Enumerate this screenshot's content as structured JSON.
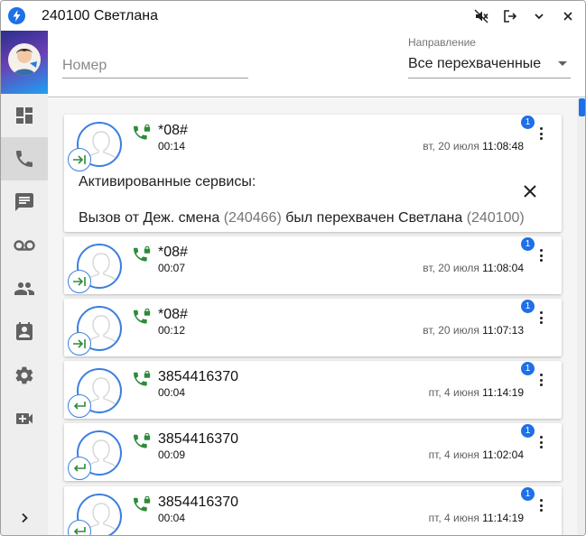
{
  "window": {
    "title": "240100 Светлана",
    "accent": "#1e6fe8"
  },
  "title_buttons": [
    {
      "name": "mute-icon"
    },
    {
      "name": "logout-icon"
    },
    {
      "name": "chevron-down-icon"
    },
    {
      "name": "close-icon"
    }
  ],
  "sidebar": {
    "items": [
      {
        "icon": "dashboard-icon",
        "active": false
      },
      {
        "icon": "phone-icon",
        "active": true
      },
      {
        "icon": "chat-icon",
        "active": false
      },
      {
        "icon": "voicemail-icon",
        "active": false
      },
      {
        "icon": "people-icon",
        "active": false
      },
      {
        "icon": "contacts-icon",
        "active": false
      },
      {
        "icon": "settings-icon",
        "active": false
      },
      {
        "icon": "video-call-icon",
        "active": false
      }
    ],
    "expand_icon": "chevron-right-icon"
  },
  "filters": {
    "number_placeholder": "Номер",
    "number_value": "",
    "direction_label": "Направление",
    "direction_value": "Все перехваченные"
  },
  "calls": [
    {
      "number": "*08#",
      "duration": "00:14",
      "date": "вт, 20 июля",
      "time": "11:08:48",
      "count": "1",
      "direction": "forwarded",
      "expanded": true,
      "services_title": "Активированные сервисы:",
      "desc_parts": [
        "Вызов от Деж. смена ",
        "(240466)",
        " был перехвачен Светлана ",
        "(240100)"
      ]
    },
    {
      "number": "*08#",
      "duration": "00:07",
      "date": "вт, 20 июля",
      "time": "11:08:04",
      "count": "1",
      "direction": "forwarded"
    },
    {
      "number": "*08#",
      "duration": "00:12",
      "date": "вт, 20 июля",
      "time": "11:07:13",
      "count": "1",
      "direction": "forwarded"
    },
    {
      "number": "3854416370",
      "duration": "00:04",
      "date": "пт, 4 июня",
      "time": "11:14:19",
      "count": "1",
      "direction": "incoming"
    },
    {
      "number": "3854416370",
      "duration": "00:09",
      "date": "пт, 4 июня",
      "time": "11:02:04",
      "count": "1",
      "direction": "incoming"
    },
    {
      "number": "3854416370",
      "duration": "00:04",
      "date": "пт, 4 июня",
      "time": "11:14:19",
      "count": "1",
      "direction": "incoming"
    }
  ]
}
